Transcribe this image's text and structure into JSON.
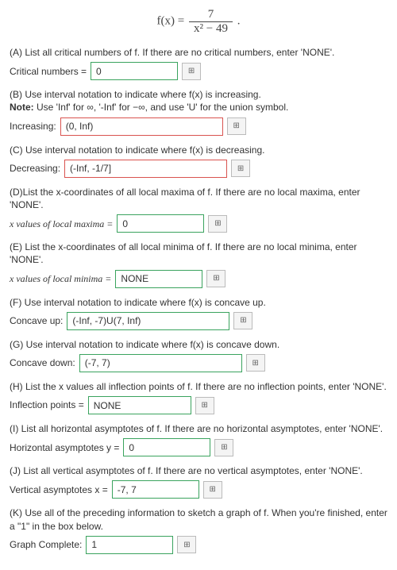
{
  "formula": {
    "lhs": "f(x) =",
    "num": "7",
    "den": "x² − 49",
    "tail": "."
  },
  "A": {
    "prompt": "(A) List all critical numbers of f. If there are no critical numbers, enter 'NONE'.",
    "label": "Critical numbers =",
    "value": "0"
  },
  "B": {
    "prompt": "(B) Use interval notation to indicate where f(x) is increasing.",
    "note_pre": "Note: ",
    "note": "Use 'Inf' for ∞, '-Inf' for −∞, and use 'U' for the union symbol.",
    "label": "Increasing:",
    "value": "(0, Inf)"
  },
  "C": {
    "prompt": "(C) Use interval notation to indicate where f(x) is decreasing.",
    "label": "Decreasing:",
    "value": "(-Inf, -1/7]"
  },
  "D": {
    "prompt": "(D)List the x-coordinates of all local maxima of f. If there are no local maxima, enter 'NONE'.",
    "label": "x values of local maxima =",
    "value": "0"
  },
  "E": {
    "prompt": "(E) List the x-coordinates of all local minima of f. If there are no local minima, enter 'NONE'.",
    "label": "x values of local minima =",
    "value": "NONE"
  },
  "F": {
    "prompt": "(F) Use interval notation to indicate where f(x) is concave up.",
    "label": "Concave up:",
    "value": "(-Inf, -7)U(7, Inf)"
  },
  "G": {
    "prompt": "(G) Use interval notation to indicate where f(x) is concave down.",
    "label": "Concave down:",
    "value": "(-7, 7)"
  },
  "H": {
    "prompt": "(H) List the x values all inflection points of f. If there are no inflection points, enter 'NONE'.",
    "label": "Inflection points =",
    "value": "NONE"
  },
  "I": {
    "prompt": "(I) List all horizontal asymptotes of f. If there are no horizontal asymptotes, enter 'NONE'.",
    "label": "Horizontal asymptotes y =",
    "value": "0"
  },
  "J": {
    "prompt": "(J) List all vertical asymptotes of f. If there are no vertical asymptotes, enter 'NONE'.",
    "label": "Vertical asymptotes x =",
    "value": "-7, 7"
  },
  "K": {
    "prompt": "(K) Use all of the preceding information to sketch a graph of f. When you're finished, enter a \"1\" in the box below.",
    "label": "Graph Complete:",
    "value": "1"
  }
}
